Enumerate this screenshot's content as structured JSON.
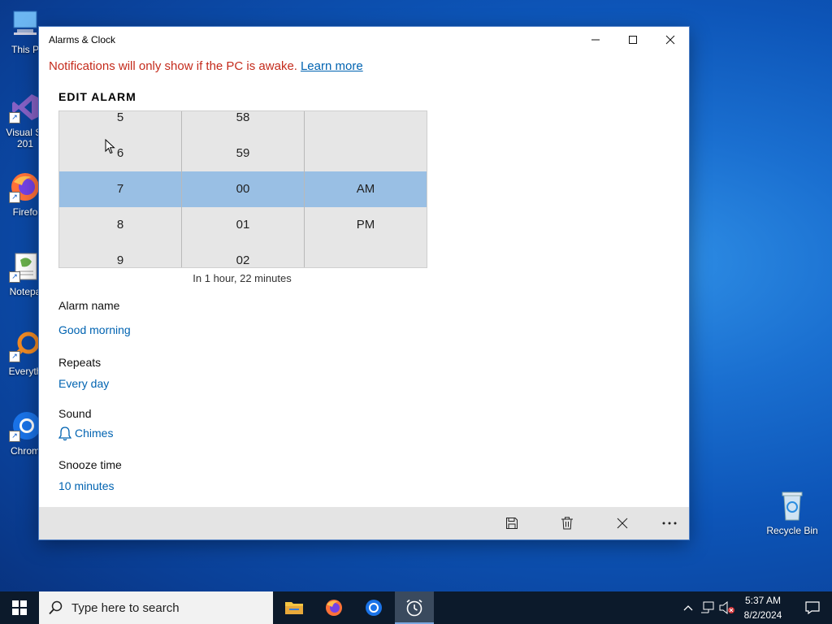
{
  "desktop": {
    "icons": [
      {
        "label": "This P",
        "name": "this-pc"
      },
      {
        "label": "Visual St\n201",
        "name": "visual-studio"
      },
      {
        "label": "Firefo",
        "name": "firefox"
      },
      {
        "label": "Notepa",
        "name": "notepad"
      },
      {
        "label": "Everyth",
        "name": "everything"
      },
      {
        "label": "Chrom",
        "name": "chrome"
      }
    ],
    "recycle_bin": "Recycle Bin"
  },
  "window": {
    "title": "Alarms & Clock",
    "notice": "Notifications will only show if the PC is awake.",
    "learn_more": "Learn more",
    "section_title": "EDIT ALARM",
    "picker": {
      "hours": [
        "5",
        "6",
        "7",
        "8",
        "9"
      ],
      "minutes": [
        "58",
        "59",
        "00",
        "01",
        "02"
      ],
      "period": [
        "",
        "",
        "AM",
        "PM",
        ""
      ],
      "selected_hour": "7",
      "selected_minute": "00",
      "selected_period": "AM"
    },
    "countdown": "In 1 hour, 22 minutes",
    "alarm_name_label": "Alarm name",
    "alarm_name_value": "Good morning",
    "repeats_label": "Repeats",
    "repeats_value": "Every day",
    "sound_label": "Sound",
    "sound_value": "Chimes",
    "snooze_label": "Snooze time",
    "snooze_value": "10 minutes"
  },
  "taskbar": {
    "search_placeholder": "Type here to search",
    "time": "5:37 AM",
    "date": "8/2/2024"
  },
  "colors": {
    "accent": "#0063b1",
    "selection": "#99bfe4",
    "notice": "#c42b1c"
  }
}
